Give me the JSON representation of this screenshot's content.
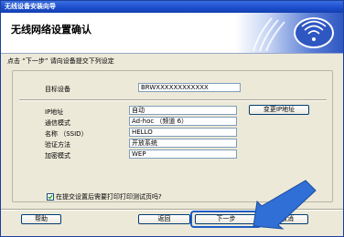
{
  "window": {
    "title": "无线设备安装向导"
  },
  "banner": {
    "heading": "无线网络设置确认"
  },
  "instruction": "点击 “下一步” 请向设备提交下列设定",
  "device": {
    "label": "目标设备",
    "value": "BRWXXXXXXXXXXXX"
  },
  "settings": {
    "ip": {
      "label": "IP地址",
      "value": "自动"
    },
    "mode": {
      "label": "通信模式",
      "value": "Ad-hoc （频道 6）"
    },
    "ssid": {
      "label": "名称 （SSID）",
      "value": "HELLO"
    },
    "auth": {
      "label": "验证方法",
      "value": "开放系统"
    },
    "enc": {
      "label": "加密模式",
      "value": "WEP"
    }
  },
  "buttons": {
    "change_ip": "变更IP地址",
    "help": "帮助",
    "back": "返回",
    "next": "下一步",
    "cancel": "取消"
  },
  "checkbox": {
    "label": "在提交设置后需要打印打印测试页吗?",
    "checked": true
  },
  "icons": {
    "banner": "wireless-signal-icon",
    "pointer": "arrow-pointer-icon"
  },
  "colors": {
    "titlebar": "#1d4fcf",
    "accent": "#1f5bc6",
    "background": "#ece9d8"
  }
}
